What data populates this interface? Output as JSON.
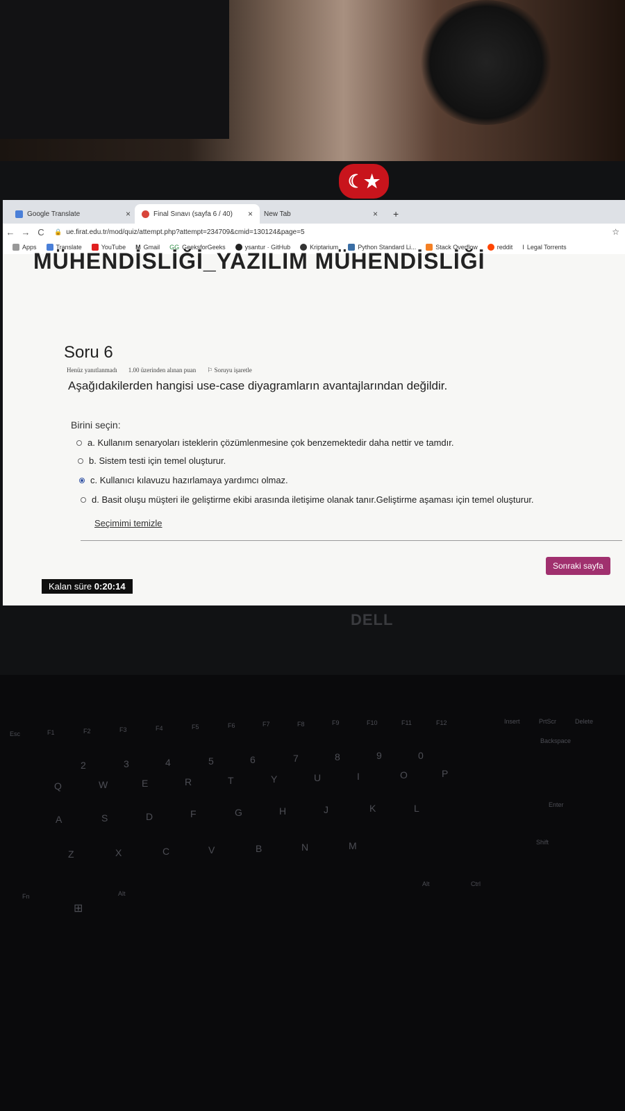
{
  "browser": {
    "tabs": [
      {
        "label": "Google Translate",
        "active": false
      },
      {
        "label": "Final Sınavı (sayfa 6 / 40)",
        "active": true
      },
      {
        "label": "New Tab",
        "active": false
      }
    ],
    "new_tab": "+",
    "url": "ue.firat.edu.tr/mod/quiz/attempt.php?attempt=234709&cmid=130124&page=5",
    "bookmarks": [
      "Apps",
      "Translate",
      "YouTube",
      "Gmail",
      "GeeksforGeeks",
      "ysantur · GitHub",
      "Kriptarium",
      "Python Standard Li...",
      "Stack Overflow",
      "reddit",
      "Legal Torrents"
    ]
  },
  "quiz": {
    "course_title": "MÜHENDİSLİĞİ_YAZILIM MÜHENDİSLİĞİ",
    "question_title": "Soru 6",
    "status": "Henüz yanıtlanmadı",
    "points": "1.00 üzerinden alınan puan",
    "flag": "Soruyu işaretle",
    "question": "Aşağıdakilerden hangisi use-case diyagramların avantajlarından değildir.",
    "choose_label": "Birini seçin:",
    "options": [
      {
        "text": "a. Kullanım senaryoları isteklerin çözümlenmesine çok benzemektedir daha nettir ve tamdır.",
        "selected": false
      },
      {
        "text": "b. Sistem testi için temel oluşturur.",
        "selected": false
      },
      {
        "text": "c. Kullanıcı kılavuzu hazırlamaya yardımcı olmaz.",
        "selected": true
      },
      {
        "text": "d. Basit oluşu müşteri ile geliştirme ekibi arasında iletişime olanak tanır.Geliştirme aşaması için temel oluşturur.",
        "selected": false
      }
    ],
    "clear_label": "Seçimimi temizle",
    "next_label": "Sonraki sayfa",
    "timer_label": "Kalan süre",
    "timer_value": "0:20:14"
  },
  "hardware": {
    "brand": "DELL",
    "flag_glyph": "☾★"
  },
  "keyboard": {
    "keys": [
      "Esc",
      "F1",
      "F2",
      "F3",
      "F4",
      "F5",
      "F6",
      "F7",
      "F8",
      "F9",
      "F10",
      "F11",
      "F12",
      "Insert",
      "PrtScr",
      "Delete",
      "Backspace",
      "Q",
      "W",
      "E",
      "R",
      "T",
      "Y",
      "U",
      "I",
      "O",
      "P",
      "Enter",
      "A",
      "S",
      "D",
      "F",
      "G",
      "H",
      "J",
      "K",
      "L",
      "Z",
      "X",
      "C",
      "V",
      "B",
      "N",
      "M",
      "Shift",
      "Fn",
      "Alt",
      "Alt",
      "Ctrl",
      "2",
      "3",
      "4",
      "5",
      "6",
      "7",
      "8",
      "9",
      "0"
    ]
  }
}
